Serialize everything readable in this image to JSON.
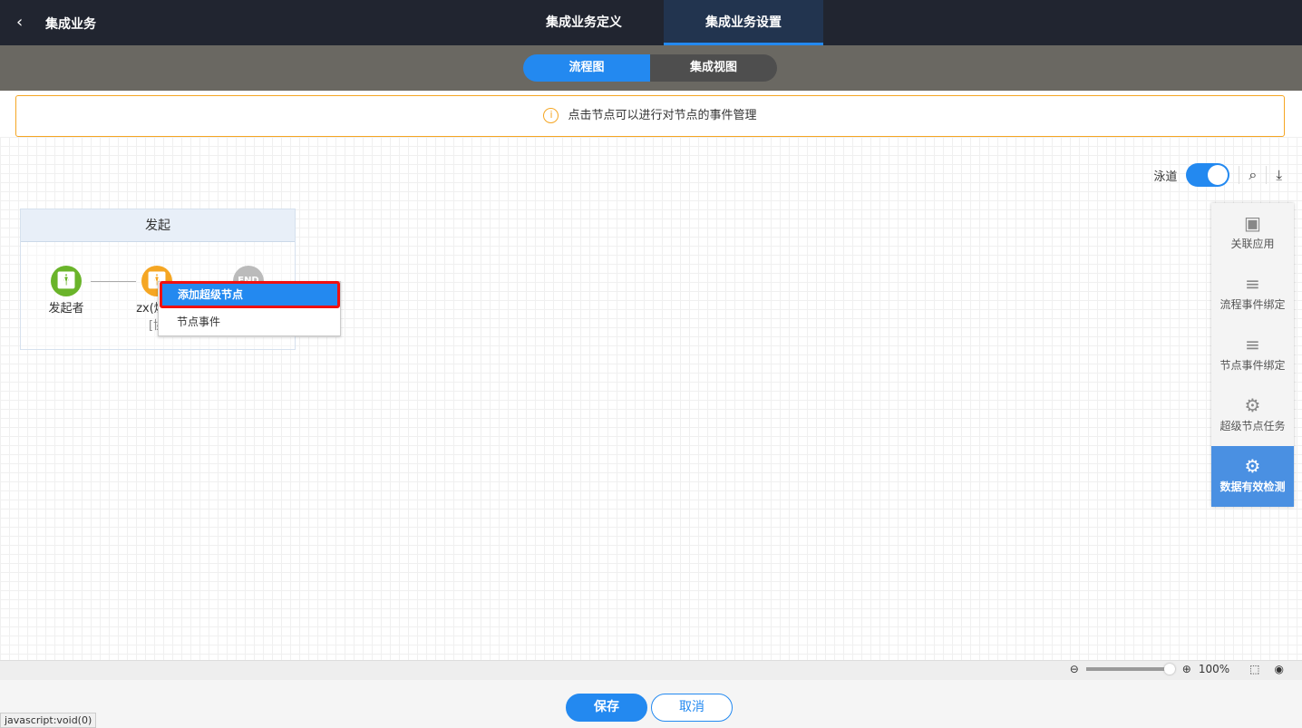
{
  "header": {
    "back_icon": "chevron-left-icon",
    "title": "集成业务",
    "tabs": [
      {
        "label": "集成业务定义"
      },
      {
        "label": "集成业务设置"
      }
    ]
  },
  "view_switch": {
    "options": [
      {
        "label": "流程图"
      },
      {
        "label": "集成视图"
      }
    ],
    "selected": "流程图"
  },
  "notice": {
    "icon": "info-icon",
    "text": "点击节点可以进行对节点的事件管理"
  },
  "toolbar": {
    "swimlane_label": "泳道",
    "swimlane_on": true
  },
  "lane": {
    "title": "发起",
    "nodes": [
      {
        "label": "发起者",
        "color": "#6ab42a"
      },
      {
        "label": "zx(燃气",
        "sub": "[协",
        "color": "#f5a623"
      },
      {
        "label": "END",
        "color": "#bbbbbb"
      }
    ]
  },
  "context_menu": {
    "items": [
      {
        "label": "添加超级节点"
      },
      {
        "label": "节点事件"
      }
    ]
  },
  "side_panel": {
    "items": [
      {
        "label": "关联应用",
        "icon": "app-window-icon"
      },
      {
        "label": "流程事件绑定",
        "icon": "event-bind-icon"
      },
      {
        "label": "节点事件绑定",
        "icon": "event-bind-icon"
      },
      {
        "label": "超级节点任务",
        "icon": "calendar-gear-icon"
      },
      {
        "label": "数据有效检测",
        "icon": "calendar-gear-icon",
        "active": true
      }
    ]
  },
  "zoom": {
    "value": "100%"
  },
  "footer": {
    "save": "保存",
    "cancel": "取消"
  },
  "status_bar": "javascript:void(0)"
}
